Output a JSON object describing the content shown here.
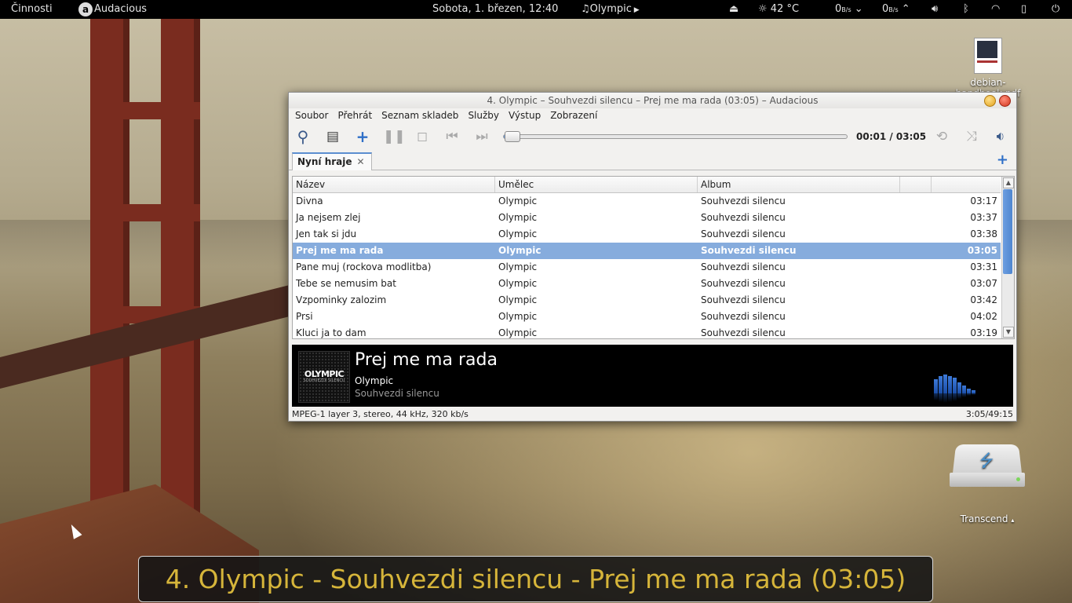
{
  "topbar": {
    "activities": "Činnosti",
    "app_icon": "audacious-icon",
    "app_name": "Audacious",
    "datetime": "Sobota,  1. březen, 12:40",
    "now_playing": "Olympic",
    "temperature": "42 °C",
    "net_down": "0",
    "net_down_unit": "B/s",
    "net_up": "0",
    "net_up_unit": "B/s"
  },
  "desktop": {
    "pdf_icon_label": "debian-handbook.pdf",
    "drive_icon_label": "Transcend"
  },
  "window": {
    "title": "4. Olympic – Souhvezdi silencu – Prej me ma rada (03:05) – Audacious",
    "menu": [
      "Soubor",
      "Přehrát",
      "Seznam skladeb",
      "Služby",
      "Výstup",
      "Zobrazení"
    ],
    "time": "00:01 / 03:05",
    "seek_fraction": 0.005,
    "tab_label": "Nyní hraje",
    "columns": [
      "Název",
      "Umělec",
      "Album",
      "",
      ""
    ],
    "tracks": [
      {
        "title": "Divna",
        "artist": "Olympic",
        "album": "Souhvezdi silencu",
        "length": "03:17"
      },
      {
        "title": "Ja nejsem zlej",
        "artist": "Olympic",
        "album": "Souhvezdi silencu",
        "length": "03:37"
      },
      {
        "title": "Jen tak si jdu",
        "artist": "Olympic",
        "album": "Souhvezdi silencu",
        "length": "03:38"
      },
      {
        "title": "Prej me ma rada",
        "artist": "Olympic",
        "album": "Souhvezdi silencu",
        "length": "03:05"
      },
      {
        "title": "Pane muj (rockova modlitba)",
        "artist": "Olympic",
        "album": "Souhvezdi silencu",
        "length": "03:31"
      },
      {
        "title": "Tebe se nemusim bat",
        "artist": "Olympic",
        "album": "Souhvezdi silencu",
        "length": "03:07"
      },
      {
        "title": "Vzpominky zalozim",
        "artist": "Olympic",
        "album": "Souhvezdi silencu",
        "length": "03:42"
      },
      {
        "title": "Prsi",
        "artist": "Olympic",
        "album": "Souhvezdi silencu",
        "length": "04:02"
      },
      {
        "title": "Kluci ja to dam",
        "artist": "Olympic",
        "album": "Souhvezdi silencu",
        "length": "03:19"
      }
    ],
    "selected_index": 3,
    "now_playing": {
      "title": "Prej me ma rada",
      "artist": "Olympic",
      "album": "Souhvezdi silencu",
      "art_text": "OLYMPIC",
      "art_subtext": "SOUHVEZDI SILENCU"
    },
    "status_left": "MPEG-1 layer 3, stereo, 44 kHz, 320 kb/s",
    "status_right": "3:05/49:15"
  },
  "osd": {
    "text": "4. Olympic - Souhvezdi silencu - Prej me ma rada (03:05)"
  },
  "colors": {
    "selection": "#86acdd",
    "osd_text": "#d6b53a",
    "accent": "#2f6fc7"
  }
}
